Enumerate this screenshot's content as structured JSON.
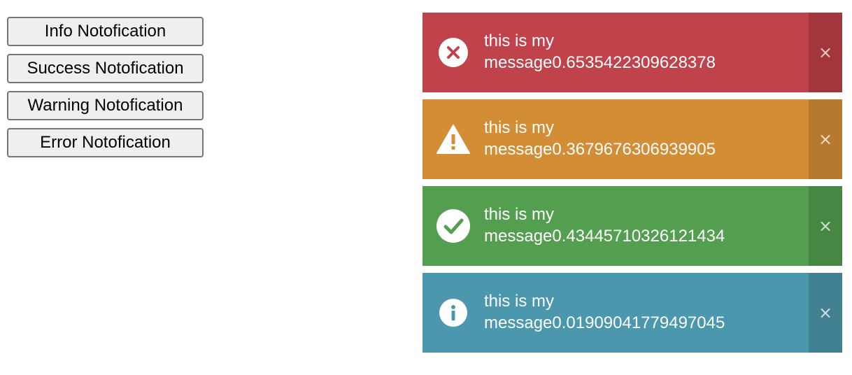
{
  "buttons": {
    "info": "Info Notofication",
    "success": "Success Notofication",
    "warning": "Warning Notofication",
    "error": "Error Notofication"
  },
  "notifications": [
    {
      "type": "error",
      "icon": "error-circle-icon",
      "message_line1": "this is my",
      "message_line2": "message0.6535422309628378",
      "close": "×",
      "color": "#c0424a"
    },
    {
      "type": "warning",
      "icon": "warning-triangle-icon",
      "message_line1": "this is my",
      "message_line2": "message0.3679676306939905",
      "close": "×",
      "color": "#d38d35"
    },
    {
      "type": "success",
      "icon": "check-circle-icon",
      "message_line1": "this is my",
      "message_line2": "message0.43445710326121434",
      "close": "×",
      "color": "#549f4f"
    },
    {
      "type": "info",
      "icon": "info-circle-icon",
      "message_line1": "this is my",
      "message_line2": "message0.01909041779497045",
      "close": "×",
      "color": "#4b97ad"
    }
  ]
}
